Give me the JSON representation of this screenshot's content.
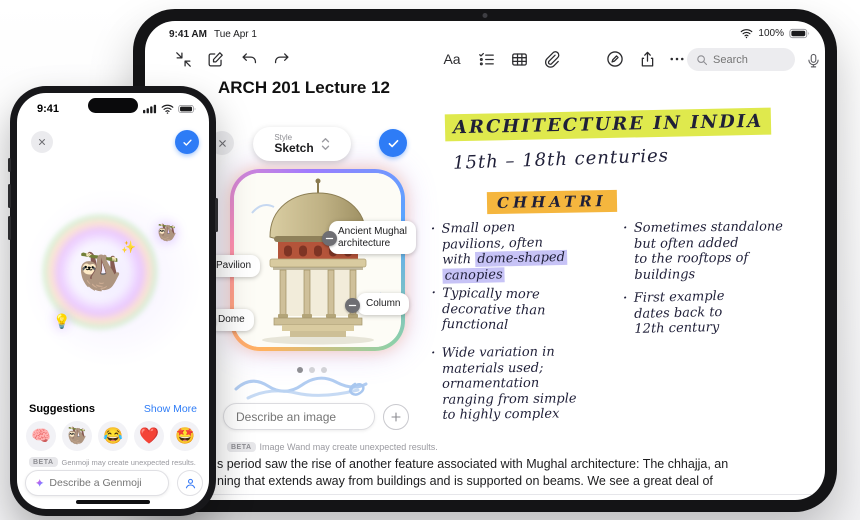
{
  "colors": {
    "accent_blue": "#2e7cf6",
    "highlight_yellow": "#dfe94d",
    "highlight_orange": "#f5b63e",
    "highlight_purple": "#c7c3f6"
  },
  "ipad": {
    "status": {
      "time": "9:41 AM",
      "date": "Tue Apr 1",
      "battery": "100%"
    },
    "toolbar": {
      "format_label": "Aa",
      "search_placeholder": "Search"
    },
    "note": {
      "title": "ARCH 201 Lecture 12",
      "heading": "ARCHITECTURE IN INDIA",
      "subheading": "15th – 18th centuries",
      "section_heading": "CHHATRI",
      "bullets_left": [
        {
          "pre": "Small open\npavilions, often\nwith ",
          "highlight": "dome-shaped\ncanopies"
        },
        {
          "text": "Typically more\ndecorative than\nfunctional"
        },
        {
          "text": "Wide variation in\nmaterials used;\nornamentation\nranging from simple\nto highly complex"
        }
      ],
      "bullets_right": [
        {
          "text": "Sometimes standalone\nbut often added\nto the rooftops of\nbuildings"
        },
        {
          "text": "First example\ndates back to\n12th century"
        }
      ],
      "body_line1": "s period saw the rise of another feature associated with Mughal architecture: The chhajja, an",
      "body_line2": "ning that extends away from buildings and is supported on beams. We see a great deal of"
    },
    "image_wand": {
      "style_label": "Style",
      "style_value": "Sketch",
      "tags": {
        "main": "Ancient Mughal\narchitecture",
        "pavilion": "Pavilion",
        "dome": "Dome",
        "column": "Column"
      },
      "placeholder": "Describe an image",
      "beta_badge": "BETA",
      "beta_text": "Image Wand may create unexpected results."
    }
  },
  "iphone": {
    "status_time": "9:41",
    "genmoji": {
      "main": "🦥",
      "sparkle": "✨",
      "thumb_top": "🦥",
      "thumb_bottom": "💡"
    },
    "suggestions_label": "Suggestions",
    "show_more": "Show More",
    "emoji": [
      "🧠",
      "🦥",
      "😂",
      "❤️",
      "🤩"
    ],
    "beta_badge": "BETA",
    "beta_text": "Genmoji may create unexpected results.",
    "placeholder": "Describe a Genmoji"
  }
}
